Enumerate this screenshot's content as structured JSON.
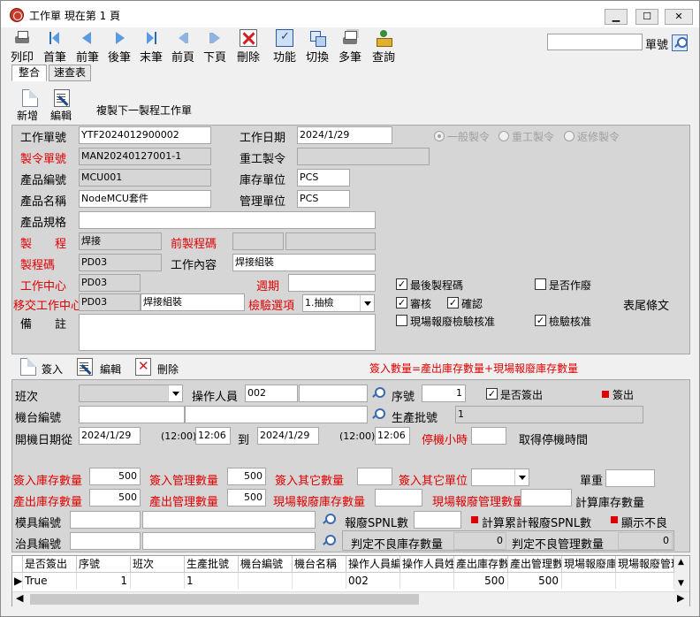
{
  "window": {
    "title": "工作單  現在第 1 頁"
  },
  "toolbar": {
    "buttons": [
      {
        "label": "列印",
        "icon": "printer-icon"
      },
      {
        "label": "首筆",
        "icon": "first-record-icon"
      },
      {
        "label": "前筆",
        "icon": "prev-record-icon"
      },
      {
        "label": "後筆",
        "icon": "next-record-icon"
      },
      {
        "label": "末筆",
        "icon": "last-record-icon"
      },
      {
        "label": "前頁",
        "icon": "prev-page-icon"
      },
      {
        "label": "下頁",
        "icon": "next-page-icon"
      },
      {
        "label": "刪除",
        "icon": "delete-icon"
      },
      {
        "label": "功能",
        "icon": "function-icon"
      },
      {
        "label": "切換",
        "icon": "switch-icon"
      },
      {
        "label": "多筆",
        "icon": "multi-record-icon"
      },
      {
        "label": "查詢",
        "icon": "query-icon"
      }
    ],
    "search_label": "單號",
    "search_value": ""
  },
  "tabs": [
    "整合",
    "速查表"
  ],
  "subbar1": {
    "new_label": "新增",
    "edit_label": "編輯",
    "copy_label": "複製下一製程工作單"
  },
  "header": {
    "work_order_no_label": "工作單號",
    "work_order_no": "YTF2024012900002",
    "work_date_label": "工作日期",
    "work_date": "2024/1/29",
    "mo_no_label": "製令單號",
    "mo_no": "MAN20240127001-1",
    "rework_label": "重工製令",
    "rework": "",
    "product_code_label": "產品編號",
    "product_code": "MCU001",
    "stock_unit_label": "庫存單位",
    "stock_unit": "PCS",
    "product_name_label": "產品名稱",
    "product_name": "NodeMCU套件",
    "mgmt_unit_label": "管理單位",
    "mgmt_unit": "PCS",
    "spec_label": "產品規格",
    "spec": "",
    "process_label": "製　　程",
    "process": "焊接",
    "prev_process_label": "前製程碼",
    "prev_process_1": "",
    "prev_process_2": "",
    "process_code_label": "製程碼",
    "process_code": "PD03",
    "work_content_label": "工作內容",
    "work_content": "焊接組裝",
    "work_center_label": "工作中心",
    "work_center": "PD03",
    "period_label": "週期",
    "period": "",
    "transfer_center_label": "移交工作中心",
    "transfer_center": "PD03",
    "transfer_center_name": "焊接組裝",
    "inspect_option_label": "檢驗選項",
    "inspect_option": "1.抽檢",
    "remark_label": "備　　註",
    "remark": "",
    "radio_normal": "一般製令",
    "radio_rework": "重工製令",
    "radio_repair": "返修製令",
    "chk_last_process": "最後製程碼",
    "chk_voided": "是否作廢",
    "chk_reviewed": "審核",
    "chk_confirmed": "確認",
    "footer_terms": "表尾條文",
    "chk_scrap_inspect": "現場報廢檢驗核准",
    "chk_inspect_approved": "檢驗核准"
  },
  "subbar2": {
    "signin_label": "簽入",
    "edit_label": "編輯",
    "delete_label": "刪除",
    "formula": "簽入數量=產出庫存數量+現場報廢庫存數量"
  },
  "detail": {
    "shift_label": "班次",
    "shift": "",
    "operator_label": "操作人員",
    "operator": "002",
    "operator_name": "",
    "seq_label": "序號",
    "seq": "1",
    "signed_out_label": "是否簽出",
    "signout_label": "簽出",
    "machine_label": "機台編號",
    "machine": "",
    "machine_name": "",
    "lot_label": "生產批號",
    "lot": "1",
    "start_date_label": "開機日期從",
    "start_date": "2024/1/29",
    "start_hint": "(12:00)",
    "start_time": "12:06",
    "to_label": "到",
    "end_date": "2024/1/29",
    "end_hint": "(12:00)",
    "end_time": "12:06",
    "downtime_label": "停機小時",
    "downtime": "",
    "get_downtime_label": "取得停機時間",
    "signin_stock_qty_label": "簽入庫存數量",
    "signin_stock_qty": "500",
    "signin_mgmt_qty_label": "簽入管理數量",
    "signin_mgmt_qty": "500",
    "signin_other_qty_label": "簽入其它數量",
    "signin_other_qty": "",
    "signin_other_unit_label": "簽入其它單位",
    "signin_other_unit": "",
    "unit_weight_label": "單重",
    "unit_weight": "",
    "output_stock_qty_label": "產出庫存數量",
    "output_stock_qty": "500",
    "output_mgmt_qty_label": "產出管理數量",
    "output_mgmt_qty": "500",
    "scrap_stock_qty_label": "現場報廢庫存數量",
    "scrap_stock_qty": "",
    "scrap_mgmt_qty_label": "現場報廢管理數量",
    "scrap_mgmt_qty": "",
    "calc_stock_qty_label": "計算庫存數量",
    "mold_label": "模具編號",
    "mold": "",
    "mold_name": "",
    "scrap_spnl_label": "報廢SPNL數",
    "scrap_spnl": "",
    "calc_scrap_spnl_label": "計算累計報廢SPNL數",
    "show_defect_label": "顯示不良",
    "fixture_label": "治具編號",
    "fixture": "",
    "fixture_name": "",
    "defect_stock_label": "判定不良庫存數量",
    "defect_stock": "0",
    "defect_mgmt_label": "判定不良管理數量",
    "defect_mgmt": "0"
  },
  "grid": {
    "columns": [
      "是否簽出",
      "序號",
      "班次",
      "生產批號",
      "機台編號",
      "機台名稱",
      "操作人員編號",
      "操作人員姓名",
      "產出庫存數量",
      "產出管理數量",
      "現場報廢庫存",
      "現場報廢管理"
    ],
    "rows": [
      [
        "True",
        "1",
        "",
        "1",
        "",
        "",
        "002",
        "",
        "500",
        "500",
        "",
        ""
      ]
    ]
  },
  "colors": {
    "required_label": "#e00000",
    "panel": "#d6d6d6"
  }
}
